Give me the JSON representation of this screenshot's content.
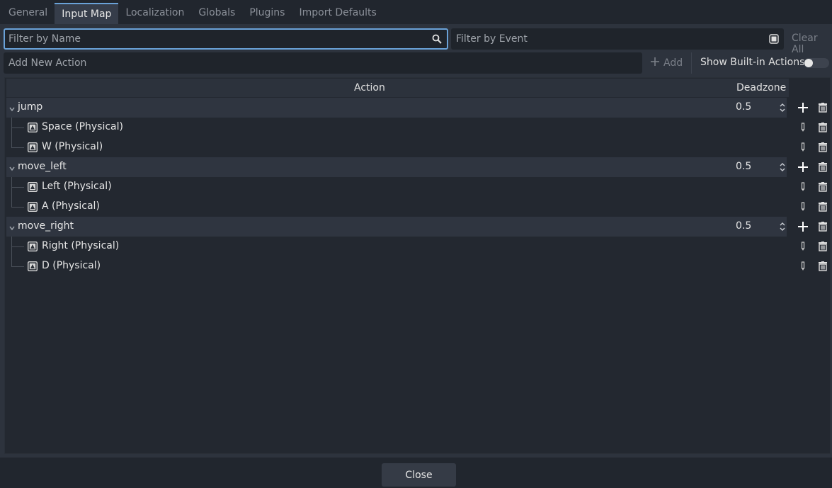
{
  "tabs": [
    "General",
    "Input Map",
    "Localization",
    "Globals",
    "Plugins",
    "Import Defaults"
  ],
  "active_tab": "Input Map",
  "filter": {
    "name_placeholder": "Filter by Name",
    "event_placeholder": "Filter by Event",
    "clear_all": "Clear All"
  },
  "add_action": {
    "placeholder": "Add New Action",
    "add_label": "Add",
    "show_builtin_label": "Show Built-in Actions",
    "show_builtin_on": false
  },
  "columns": {
    "action": "Action",
    "deadzone": "Deadzone"
  },
  "actions": [
    {
      "name": "jump",
      "deadzone": "0.5",
      "events": [
        "Space (Physical)",
        "W (Physical)"
      ]
    },
    {
      "name": "move_left",
      "deadzone": "0.5",
      "events": [
        "Left (Physical)",
        "A (Physical)"
      ]
    },
    {
      "name": "move_right",
      "deadzone": "0.5",
      "events": [
        "Right (Physical)",
        "D (Physical)"
      ]
    }
  ],
  "footer": {
    "close_label": "Close"
  },
  "colors": {
    "accent": "#6aa2d8",
    "panel": "#2d333d",
    "background": "#21262e"
  }
}
